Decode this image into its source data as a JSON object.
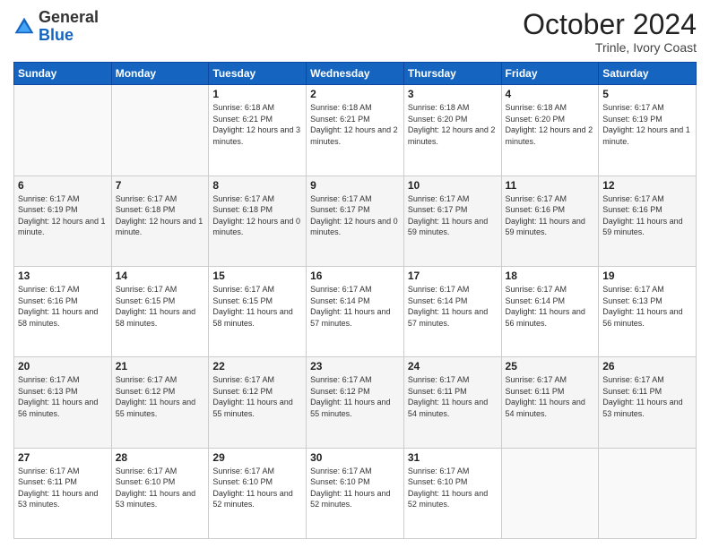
{
  "header": {
    "logo_general": "General",
    "logo_blue": "Blue",
    "month": "October 2024",
    "location": "Trinle, Ivory Coast"
  },
  "weekdays": [
    "Sunday",
    "Monday",
    "Tuesday",
    "Wednesday",
    "Thursday",
    "Friday",
    "Saturday"
  ],
  "weeks": [
    [
      {
        "day": "",
        "info": ""
      },
      {
        "day": "",
        "info": ""
      },
      {
        "day": "1",
        "info": "Sunrise: 6:18 AM\nSunset: 6:21 PM\nDaylight: 12 hours and 3 minutes."
      },
      {
        "day": "2",
        "info": "Sunrise: 6:18 AM\nSunset: 6:21 PM\nDaylight: 12 hours and 2 minutes."
      },
      {
        "day": "3",
        "info": "Sunrise: 6:18 AM\nSunset: 6:20 PM\nDaylight: 12 hours and 2 minutes."
      },
      {
        "day": "4",
        "info": "Sunrise: 6:18 AM\nSunset: 6:20 PM\nDaylight: 12 hours and 2 minutes."
      },
      {
        "day": "5",
        "info": "Sunrise: 6:17 AM\nSunset: 6:19 PM\nDaylight: 12 hours and 1 minute."
      }
    ],
    [
      {
        "day": "6",
        "info": "Sunrise: 6:17 AM\nSunset: 6:19 PM\nDaylight: 12 hours and 1 minute."
      },
      {
        "day": "7",
        "info": "Sunrise: 6:17 AM\nSunset: 6:18 PM\nDaylight: 12 hours and 1 minute."
      },
      {
        "day": "8",
        "info": "Sunrise: 6:17 AM\nSunset: 6:18 PM\nDaylight: 12 hours and 0 minutes."
      },
      {
        "day": "9",
        "info": "Sunrise: 6:17 AM\nSunset: 6:17 PM\nDaylight: 12 hours and 0 minutes."
      },
      {
        "day": "10",
        "info": "Sunrise: 6:17 AM\nSunset: 6:17 PM\nDaylight: 11 hours and 59 minutes."
      },
      {
        "day": "11",
        "info": "Sunrise: 6:17 AM\nSunset: 6:16 PM\nDaylight: 11 hours and 59 minutes."
      },
      {
        "day": "12",
        "info": "Sunrise: 6:17 AM\nSunset: 6:16 PM\nDaylight: 11 hours and 59 minutes."
      }
    ],
    [
      {
        "day": "13",
        "info": "Sunrise: 6:17 AM\nSunset: 6:16 PM\nDaylight: 11 hours and 58 minutes."
      },
      {
        "day": "14",
        "info": "Sunrise: 6:17 AM\nSunset: 6:15 PM\nDaylight: 11 hours and 58 minutes."
      },
      {
        "day": "15",
        "info": "Sunrise: 6:17 AM\nSunset: 6:15 PM\nDaylight: 11 hours and 58 minutes."
      },
      {
        "day": "16",
        "info": "Sunrise: 6:17 AM\nSunset: 6:14 PM\nDaylight: 11 hours and 57 minutes."
      },
      {
        "day": "17",
        "info": "Sunrise: 6:17 AM\nSunset: 6:14 PM\nDaylight: 11 hours and 57 minutes."
      },
      {
        "day": "18",
        "info": "Sunrise: 6:17 AM\nSunset: 6:14 PM\nDaylight: 11 hours and 56 minutes."
      },
      {
        "day": "19",
        "info": "Sunrise: 6:17 AM\nSunset: 6:13 PM\nDaylight: 11 hours and 56 minutes."
      }
    ],
    [
      {
        "day": "20",
        "info": "Sunrise: 6:17 AM\nSunset: 6:13 PM\nDaylight: 11 hours and 56 minutes."
      },
      {
        "day": "21",
        "info": "Sunrise: 6:17 AM\nSunset: 6:12 PM\nDaylight: 11 hours and 55 minutes."
      },
      {
        "day": "22",
        "info": "Sunrise: 6:17 AM\nSunset: 6:12 PM\nDaylight: 11 hours and 55 minutes."
      },
      {
        "day": "23",
        "info": "Sunrise: 6:17 AM\nSunset: 6:12 PM\nDaylight: 11 hours and 55 minutes."
      },
      {
        "day": "24",
        "info": "Sunrise: 6:17 AM\nSunset: 6:11 PM\nDaylight: 11 hours and 54 minutes."
      },
      {
        "day": "25",
        "info": "Sunrise: 6:17 AM\nSunset: 6:11 PM\nDaylight: 11 hours and 54 minutes."
      },
      {
        "day": "26",
        "info": "Sunrise: 6:17 AM\nSunset: 6:11 PM\nDaylight: 11 hours and 53 minutes."
      }
    ],
    [
      {
        "day": "27",
        "info": "Sunrise: 6:17 AM\nSunset: 6:11 PM\nDaylight: 11 hours and 53 minutes."
      },
      {
        "day": "28",
        "info": "Sunrise: 6:17 AM\nSunset: 6:10 PM\nDaylight: 11 hours and 53 minutes."
      },
      {
        "day": "29",
        "info": "Sunrise: 6:17 AM\nSunset: 6:10 PM\nDaylight: 11 hours and 52 minutes."
      },
      {
        "day": "30",
        "info": "Sunrise: 6:17 AM\nSunset: 6:10 PM\nDaylight: 11 hours and 52 minutes."
      },
      {
        "day": "31",
        "info": "Sunrise: 6:17 AM\nSunset: 6:10 PM\nDaylight: 11 hours and 52 minutes."
      },
      {
        "day": "",
        "info": ""
      },
      {
        "day": "",
        "info": ""
      }
    ]
  ]
}
